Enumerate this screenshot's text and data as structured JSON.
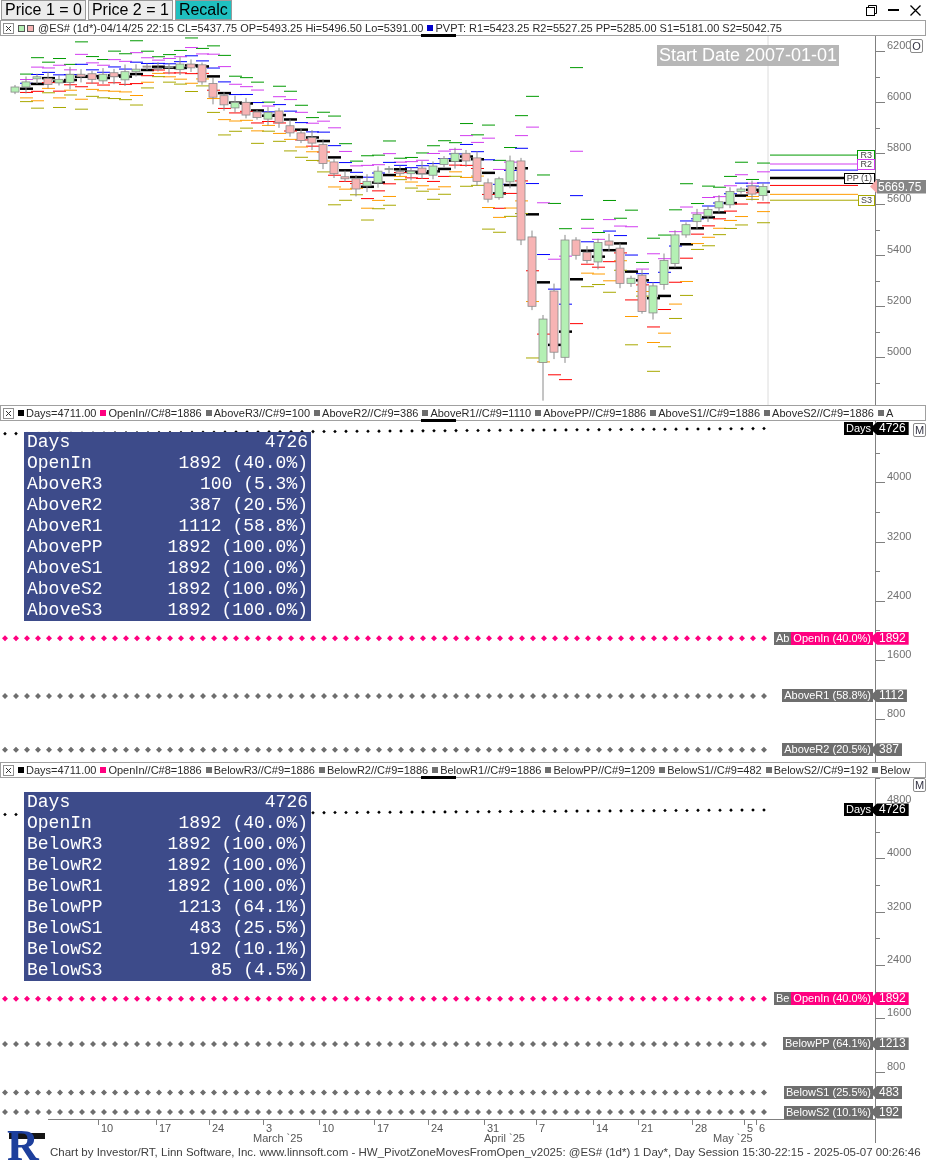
{
  "toolbar": {
    "buttons": [
      {
        "label": "Price 1 = 0",
        "kind": "plain"
      },
      {
        "label": "Price 2 = 1",
        "kind": "plain"
      },
      {
        "label": "Recalc",
        "kind": "accent"
      }
    ]
  },
  "price_panel": {
    "legend": [
      {
        "kind": "candles",
        "text": "@ES# (1d*)-04/14/25 22:15 CL=5437.75 OP=5493.25 Hi=5496.50 Lo=5391.00"
      },
      {
        "kind": "square",
        "color": "#0000cc",
        "text": "PVPT: R1=5423.25 R2=5527.25 PP=5285.00 S1=5181.00 S2=5042.75"
      }
    ],
    "start_date": "Start Date 2007-01-01",
    "corner_button": "O",
    "yticks": [
      "6200",
      "6000",
      "5800",
      "5600",
      "5400",
      "5200",
      "5000"
    ],
    "pivot_labels": [
      {
        "kind": "r3",
        "text": "R3",
        "color": "#009a00"
      },
      {
        "kind": "r2",
        "text": "R2",
        "color": "#d23cf0"
      },
      {
        "kind": "pp",
        "text": "PP (1)",
        "color": "#000000"
      },
      {
        "kind": "s3",
        "text": "S3",
        "color": "#a8a800"
      }
    ],
    "last_price": "5669.75"
  },
  "above_panel": {
    "legend": [
      {
        "kind": "square",
        "color": "#000000",
        "text": "Days=4711.00"
      },
      {
        "kind": "square",
        "color": "#ff0080",
        "text": "OpenIn//C#8=1886"
      },
      {
        "kind": "square",
        "color": "#6e6e6e",
        "text": "AboveR3//C#9=100"
      },
      {
        "kind": "square",
        "color": "#6e6e6e",
        "text": "AboveR2//C#9=386"
      },
      {
        "kind": "square",
        "color": "#6e6e6e",
        "text": "AboveR1//C#9=1110"
      },
      {
        "kind": "square",
        "color": "#6e6e6e",
        "text": "AbovePP//C#9=1886"
      },
      {
        "kind": "square",
        "color": "#6e6e6e",
        "text": "AboveS1//C#9=1886"
      },
      {
        "kind": "square",
        "color": "#6e6e6e",
        "text": "AboveS2//C#9=1886"
      },
      {
        "kind": "square",
        "color": "#6e6e6e",
        "text": "A"
      }
    ],
    "corner_button": "M",
    "stats": [
      {
        "label": "Days",
        "value": "4726"
      },
      {
        "label": "OpenIn",
        "value": "1892 (40.0%)"
      },
      {
        "label": "AboveR3",
        "value": "100 (5.3%)"
      },
      {
        "label": "AboveR2",
        "value": "387 (20.5%)"
      },
      {
        "label": "AboveR1",
        "value": "1112 (58.8%)"
      },
      {
        "label": "AbovePP",
        "value": "1892 (100.0%)"
      },
      {
        "label": "AboveS1",
        "value": "1892 (100.0%)"
      },
      {
        "label": "AboveS2",
        "value": "1892 (100.0%)"
      },
      {
        "label": "AboveS3",
        "value": "1892 (100.0%)"
      }
    ],
    "yticks": [
      "4000",
      "3200",
      "2400",
      "1600",
      "800"
    ],
    "series": [
      {
        "label": "Days",
        "value": "4726",
        "color": "#000000"
      },
      {
        "label": "OpenIn (40.0%)",
        "value": "1892",
        "color": "#ff0080",
        "covered_label": "Ab"
      },
      {
        "label": "AboveR1 (58.8%)",
        "value": "1112",
        "color": "#6e6e6e"
      },
      {
        "label": "AboveR2 (20.5%)",
        "value": "387",
        "color": "#6e6e6e"
      }
    ]
  },
  "below_panel": {
    "legend": [
      {
        "kind": "square",
        "color": "#000000",
        "text": "Days=4711.00"
      },
      {
        "kind": "square",
        "color": "#ff0080",
        "text": "OpenIn//C#8=1886"
      },
      {
        "kind": "square",
        "color": "#6e6e6e",
        "text": "BelowR3//C#9=1886"
      },
      {
        "kind": "square",
        "color": "#6e6e6e",
        "text": "BelowR2//C#9=1886"
      },
      {
        "kind": "square",
        "color": "#6e6e6e",
        "text": "BelowR1//C#9=1886"
      },
      {
        "kind": "square",
        "color": "#6e6e6e",
        "text": "BelowPP//C#9=1209"
      },
      {
        "kind": "square",
        "color": "#6e6e6e",
        "text": "BelowS1//C#9=482"
      },
      {
        "kind": "square",
        "color": "#6e6e6e",
        "text": "BelowS2//C#9=192"
      },
      {
        "kind": "square",
        "color": "#6e6e6e",
        "text": "Below"
      }
    ],
    "corner_button": "M",
    "stats": [
      {
        "label": "Days",
        "value": "4726"
      },
      {
        "label": "OpenIn",
        "value": "1892 (40.0%)"
      },
      {
        "label": "BelowR3",
        "value": "1892 (100.0%)"
      },
      {
        "label": "BelowR2",
        "value": "1892 (100.0%)"
      },
      {
        "label": "BelowR1",
        "value": "1892 (100.0%)"
      },
      {
        "label": "BelowPP",
        "value": "1213 (64.1%)"
      },
      {
        "label": "BelowS1",
        "value": "483 (25.5%)"
      },
      {
        "label": "BelowS2",
        "value": "192 (10.1%)"
      },
      {
        "label": "BelowS3",
        "value": "85 (4.5%)"
      }
    ],
    "yticks": [
      "4800",
      "4000",
      "3200",
      "2400",
      "1600",
      "800"
    ],
    "series": [
      {
        "label": "Days",
        "value": "4726",
        "color": "#000000"
      },
      {
        "label": "OpenIn (40.0%)",
        "value": "1892",
        "color": "#ff0080",
        "covered_label": "Be"
      },
      {
        "label": "BelowPP (64.1%)",
        "value": "1213",
        "color": "#6e6e6e"
      },
      {
        "label": "BelowS1 (25.5%)",
        "value": "483",
        "color": "#6e6e6e"
      },
      {
        "label": "BelowS2 (10.1%)",
        "value": "192",
        "color": "#6e6e6e"
      }
    ]
  },
  "date_axis": {
    "days": [
      "10",
      "17",
      "24",
      "3",
      "10",
      "17",
      "24",
      "31",
      "7",
      "14",
      "21",
      "28",
      "5",
      "6"
    ],
    "months": [
      "March `25",
      "April `25",
      "May `25"
    ]
  },
  "logo": {
    "letter": "R"
  },
  "footer": "Chart by Investor/RT, Linn Software, Inc. www.linnsoft.com - HW_PivotZoneMovesFromOpen_v2025: @ES# (1d*) 1 Day*, Day Session 15:30-22:15 - 2025-05-07 00:26:46"
}
